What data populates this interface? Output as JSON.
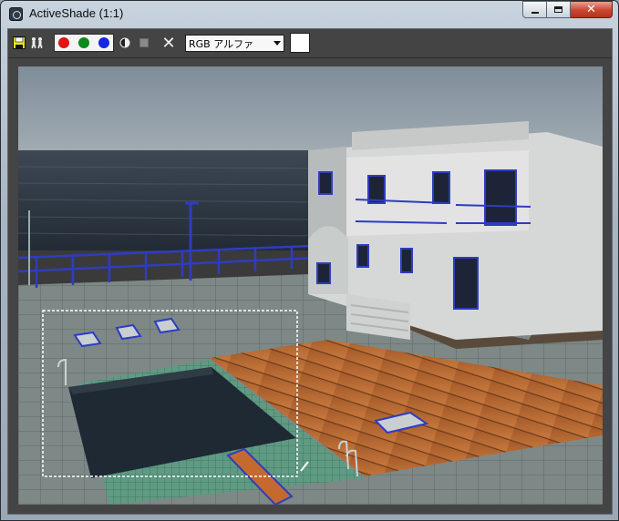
{
  "window": {
    "title": "ActiveShade (1:1)"
  },
  "toolbar": {
    "channel_dropdown_value": "RGB アルファ",
    "buttons": {
      "save": "save-icon",
      "clone": "clone-icon",
      "red": "red-channel",
      "green": "green-channel",
      "blue": "blue-channel",
      "mono": "mono-icon",
      "clear": "clear-icon",
      "close": "close-icon"
    },
    "swatch_color": "#ffffff"
  },
  "render": {
    "description_colors": {
      "sky": "#8a98a4",
      "sea": "#2a3542",
      "deck": "#b86a34",
      "pool": "#1e2933",
      "tiles": "#7f8b8a"
    }
  }
}
